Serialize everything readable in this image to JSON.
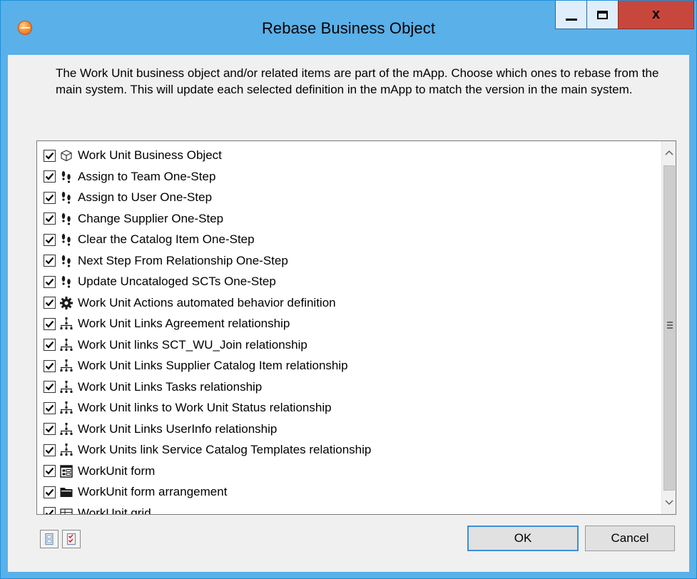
{
  "window": {
    "title": "Rebase Business Object",
    "controls": {
      "minimize": "minimize",
      "maximize": "maximize",
      "close": "close"
    }
  },
  "description": "The Work Unit business object and/or related items are part of the mApp. Choose which ones to rebase from the main system. This will update each selected definition in the mApp to match the version in the main system.",
  "items": [
    {
      "label": "Work Unit Business Object",
      "icon": "cube-icon",
      "checked": true
    },
    {
      "label": "Assign to Team One-Step",
      "icon": "footsteps-icon",
      "checked": true
    },
    {
      "label": "Assign to User One-Step",
      "icon": "footsteps-icon",
      "checked": true
    },
    {
      "label": "Change Supplier One-Step",
      "icon": "footsteps-icon",
      "checked": true
    },
    {
      "label": "Clear the Catalog Item One-Step",
      "icon": "footsteps-icon",
      "checked": true
    },
    {
      "label": "Next Step From Relationship One-Step",
      "icon": "footsteps-icon",
      "checked": true
    },
    {
      "label": "Update Uncataloged SCTs One-Step",
      "icon": "footsteps-icon",
      "checked": true
    },
    {
      "label": "Work Unit Actions automated behavior definition",
      "icon": "gear-icon",
      "checked": true
    },
    {
      "label": "Work Unit Links Agreement relationship",
      "icon": "relationship-icon",
      "checked": true
    },
    {
      "label": "Work Unit links SCT_WU_Join relationship",
      "icon": "relationship-icon",
      "checked": true
    },
    {
      "label": "Work Unit Links Supplier Catalog Item relationship",
      "icon": "relationship-icon",
      "checked": true
    },
    {
      "label": "Work Unit Links Tasks relationship",
      "icon": "relationship-icon",
      "checked": true
    },
    {
      "label": "Work Unit links to Work Unit Status relationship",
      "icon": "relationship-icon",
      "checked": true
    },
    {
      "label": "Work Unit Links UserInfo relationship",
      "icon": "relationship-icon",
      "checked": true
    },
    {
      "label": "Work Units link Service Catalog Templates relationship",
      "icon": "relationship-icon",
      "checked": true
    },
    {
      "label": "WorkUnit form",
      "icon": "form-icon",
      "checked": true
    },
    {
      "label": "WorkUnit form arrangement",
      "icon": "folder-icon",
      "checked": true
    },
    {
      "label": "WorkUnit grid",
      "icon": "grid-icon",
      "checked": true
    }
  ],
  "scrollbar": {
    "up": "▲",
    "down": "▼"
  },
  "buttons": {
    "ok": "OK",
    "cancel": "Cancel"
  },
  "bottom_icons": [
    "deselect-all-icon",
    "select-all-icon"
  ],
  "colors": {
    "titlebar": "#5ab0e8",
    "close": "#c8473d",
    "ok_border": "#3c8fdc"
  }
}
